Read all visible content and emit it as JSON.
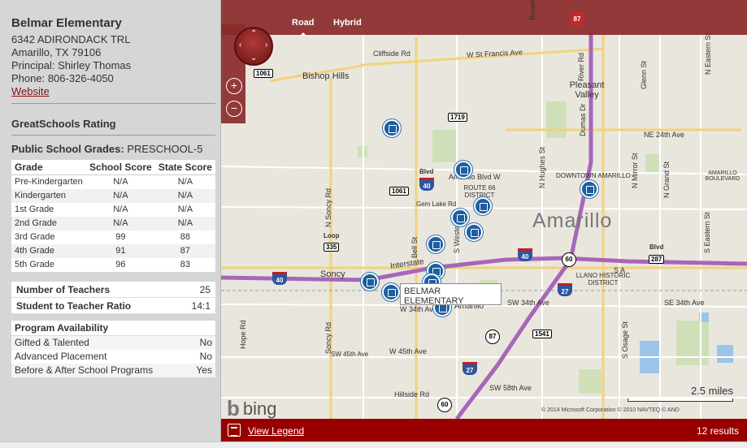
{
  "school": {
    "name": "Belmar Elementary",
    "address_line1": "6342 ADIRONDACK TRL",
    "address_line2": "Amarillo, TX 79106",
    "principal": "Principal: Shirley Thomas",
    "phone": "Phone: 806-326-4050",
    "website_label": "Website"
  },
  "rating": {
    "title": "GreatSchools Rating"
  },
  "grades": {
    "label": "Public School Grades:",
    "value": "PRESCHOOL-5",
    "headers": [
      "Grade",
      "School Score",
      "State Score"
    ],
    "rows": [
      [
        "Pre-Kindergarten",
        "N/A",
        "N/A"
      ],
      [
        "Kindergarten",
        "N/A",
        "N/A"
      ],
      [
        "1st Grade",
        "N/A",
        "N/A"
      ],
      [
        "2nd Grade",
        "N/A",
        "N/A"
      ],
      [
        "3rd Grade",
        "99",
        "88"
      ],
      [
        "4th Grade",
        "91",
        "87"
      ],
      [
        "5th Grade",
        "96",
        "83"
      ]
    ]
  },
  "stats": [
    {
      "label": "Number of Teachers",
      "value": "25"
    },
    {
      "label": "Student to Teacher Ratio",
      "value": "14:1"
    }
  ],
  "programs": {
    "title": "Program Availability",
    "rows": [
      {
        "label": "Gifted & Talented",
        "value": "No"
      },
      {
        "label": "Advanced Placement",
        "value": "No"
      },
      {
        "label": "Before & After School Programs",
        "value": "Yes"
      }
    ]
  },
  "map": {
    "tabs": [
      "Road",
      "Hybrid"
    ],
    "active_tab": "Road",
    "city_label": "Amarillo",
    "callout": "BELMAR ELEMENTARY",
    "provider": "bing",
    "scale_label": "2.5 miles",
    "copyright": "© 2014 Microsoft Corporation   © 2010 NAVTEQ   © AND",
    "legend_label": "View Legend",
    "results_label": "12 results",
    "labels": {
      "cliffside": "Cliffside Rd",
      "stfrancis": "W St Francis Ave",
      "bishophills": "Bishop Hills",
      "pleasantvalley": "Pleasant Valley",
      "ne24": "NE 24th Ave",
      "amarilloblvd": "Amarillo Blvd W",
      "downtown": "DOWNTOWN AMARILLO",
      "amarilloboulevard": "AMARILLO BOULEVARD",
      "route66": "ROUTE 66 DISTRICT",
      "gemlake": "Gem Lake Rd",
      "soncy": "Soncy",
      "interstate": "Interstate",
      "llano": "LLANO HISTORIC DISTRICT",
      "sw34": "SW 34th Ave",
      "w34": "W 34th Ave",
      "se34": "SE 34th Ave",
      "sw45": "SW 45th Ave",
      "w45": "W 45th Ave",
      "sw58": "SW 58th Ave",
      "hillside": "Hillside Rd",
      "loop": "Loop",
      "blvd": "Blvd",
      "blvd2": "Blvd",
      "amarillo_small": "Amarillo",
      "broadway": "Broadway",
      "riverrd": "River Rd",
      "dumas": "Dumas Dr",
      "glenn": "Glenn St",
      "neastern": "N Eastern St",
      "nhughes": "N Hughes St",
      "nmirror": "N Mirror St",
      "ngrand": "N Grand St",
      "seastern": "S Eastern St",
      "nsoncy": "N Soncy Rd",
      "soncyrd": "Soncy Rd",
      "bell": "Bell St",
      "hope": "Hope Rd",
      "sosage": "S Osage St",
      "swestern": "S Western",
      "sa": "S A"
    },
    "shields": {
      "s1061a": "1061",
      "s1719": "1719",
      "s1061b": "1061",
      "s335": "335",
      "s1541": "1541",
      "s287": "287",
      "i40a": "40",
      "i40b": "40",
      "i40c": "40",
      "i27a": "27",
      "i27b": "27",
      "us87a": "87",
      "us87b": "87",
      "us60a": "60",
      "us60b": "60"
    }
  }
}
